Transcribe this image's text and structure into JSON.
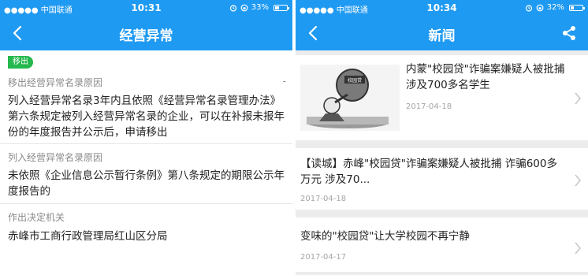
{
  "status_left": {
    "carrier": "●●●●● 中国联通",
    "time": "10:31",
    "battery_text": "33%",
    "battery_level": 0.33
  },
  "status_right": {
    "carrier": "●●●●● 中国联通",
    "time": "10:34",
    "battery_text": "32%",
    "battery_level": 0.32
  },
  "left_screen": {
    "title": "经营异常",
    "badge": "移出",
    "dash": "-",
    "sections": [
      {
        "label": "移出经营异常名录原因",
        "text": "列入经营异常名录3年内且依照《经营异常名录管理办法》第六条规定被列入经营异常名录的企业，可以在补报未报年份的年度报告并公示后，申请移出"
      },
      {
        "label": "列入经营异常名录原因",
        "text": "未依照《企业信息公示暂行条例》第八条规定的期限公示年度报告的"
      },
      {
        "label": "作出决定机关",
        "text": "赤峰市工商行政管理局红山区分局"
      }
    ]
  },
  "right_screen": {
    "title": "新闻",
    "articles": [
      {
        "title": "内蒙\"校园贷\"诈骗案嫌疑人被批捕 涉及700多名学生",
        "date": "2017-04-18",
        "thumb_text": "校园贷"
      },
      {
        "title": "【读城】赤峰\"校园贷\"诈骗案嫌疑人被批捕 诈骗600多万元 涉及70...",
        "date": "2017-04-18"
      },
      {
        "title": "变味的\"校园贷\"让大学校园不再宁静",
        "date": "2017-04-17"
      }
    ]
  },
  "colors": {
    "nav_blue": "#1f9af2",
    "badge_green": "#24b84d"
  },
  "icons": [
    "back-arrow-icon",
    "share-icon",
    "chevron-right-icon",
    "wifi-icon",
    "alarm-icon",
    "lock-rotation-icon",
    "battery-icon"
  ]
}
